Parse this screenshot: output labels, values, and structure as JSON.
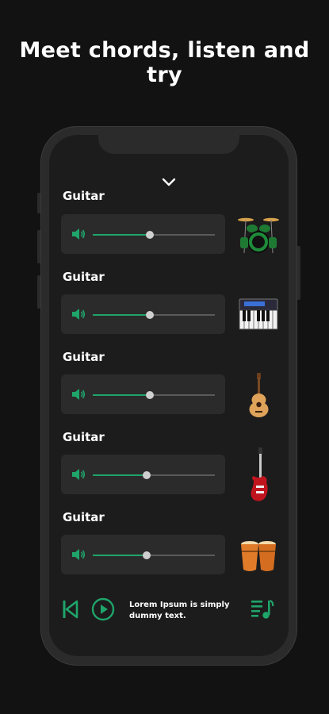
{
  "headline": "Meet chords, listen and try",
  "tracks": [
    {
      "label": "Guitar",
      "volume": 0.47,
      "instrument_icon": "drum-kit-icon"
    },
    {
      "label": "Guitar",
      "volume": 0.47,
      "instrument_icon": "keyboard-icon"
    },
    {
      "label": "Guitar",
      "volume": 0.47,
      "instrument_icon": "acoustic-guitar-icon"
    },
    {
      "label": "Guitar",
      "volume": 0.44,
      "instrument_icon": "electric-guitar-icon"
    },
    {
      "label": "Guitar",
      "volume": 0.44,
      "instrument_icon": "bongo-icon"
    }
  ],
  "player": {
    "caption": "Lorem Ipsum is simply dummy text.",
    "prev_icon": "skip-previous-icon",
    "play_icon": "play-icon",
    "playlist_icon": "playlist-music-icon"
  },
  "colors": {
    "accent": "#1fa46a",
    "background": "#121212",
    "screen": "#1c1c1c",
    "card": "#2b2b2b"
  }
}
